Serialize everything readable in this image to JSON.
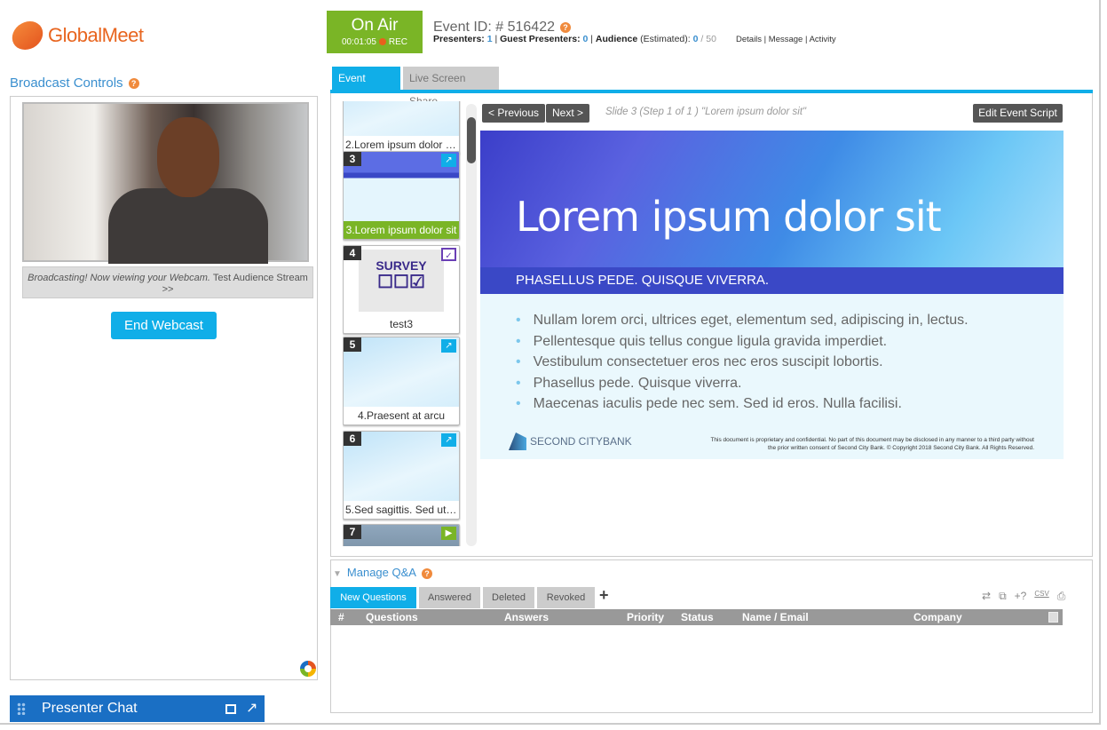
{
  "brand": {
    "name": "GlobalMeet"
  },
  "left": {
    "title": "Broadcast Controls",
    "caption_italic": "Broadcasting! Now viewing your Webcam.",
    "caption_link": "Test Audience Stream >>",
    "end_button": "End Webcast"
  },
  "chat": {
    "title": "Presenter Chat"
  },
  "status": {
    "on_air": "On Air",
    "timer": "00:01:05",
    "rec": "REC"
  },
  "event": {
    "id_label": "Event ID: # 516422",
    "presenters_label": "Presenters:",
    "presenters": "1",
    "guest_label": "Guest Presenters:",
    "guests": "0",
    "audience_label": "Audience",
    "estimated": "(Estimated):",
    "audience": "0",
    "audience_max": "/ 50",
    "links": [
      "Details",
      "Message",
      "Activity"
    ]
  },
  "tabs": [
    "Event Script",
    "Live Screen Share"
  ],
  "thumbnails": [
    {
      "num": "",
      "label": "2.Lorem ipsum dolor s...",
      "icon": ""
    },
    {
      "num": "3",
      "label": "3.Lorem ipsum dolor sit",
      "icon": "chart-icon",
      "selected": true
    },
    {
      "num": "4",
      "label": "test3",
      "icon": "survey-check-icon",
      "survey_text": "SURVEY"
    },
    {
      "num": "5",
      "label": "4.Praesent at arcu",
      "icon": "chart-icon"
    },
    {
      "num": "6",
      "label": "5.Sed sagittis. Sed ut n...",
      "icon": "chart-icon"
    },
    {
      "num": "7",
      "label": "",
      "icon": "play-icon"
    }
  ],
  "slide_nav": {
    "previous": "< Previous",
    "next": "Next >",
    "info": "Slide 3 (Step 1 of 1 ) \"Lorem ipsum dolor sit\"",
    "edit": "Edit Event Script"
  },
  "slide": {
    "title": "Lorem ipsum dolor sit",
    "subtitle": "PHASELLUS PEDE. QUISQUE VIVERRA.",
    "bullets": [
      "Nullam lorem orci, ultrices eget, elementum sed, adipiscing in, lectus.",
      "Pellentesque quis tellus congue ligula gravida imperdiet.",
      "Vestibulum consectetuer eros nec eros suscipit lobortis.",
      "Phasellus pede. Quisque viverra.",
      "Maecenas iaculis pede nec sem. Sed id eros. Nulla facilisi."
    ],
    "logo": "SECOND CITYBANK",
    "legal1": "This document is proprietary and confidential. No part of this document may be disclosed in any manner to a third party without",
    "legal2": "the prior written consent of Second City Bank. © Copyright 2018 Second City Bank.  All Rights Reserved."
  },
  "qa": {
    "title": "Manage Q&A",
    "tabs": [
      "New Questions",
      "Answered",
      "Deleted",
      "Revoked"
    ],
    "columns": [
      "#",
      "Questions",
      "Answers",
      "Priority",
      "Status",
      "Name / Email",
      "Company"
    ],
    "tools": [
      "refresh-icon",
      "popout-icon",
      "add-question-icon",
      "csv-icon",
      "print-icon"
    ],
    "csv": "CSV"
  },
  "colors": {
    "accent": "#10aee8",
    "green": "#7ab526",
    "brand_orange": "#e8651f",
    "chat_blue": "#1a6fc4"
  }
}
